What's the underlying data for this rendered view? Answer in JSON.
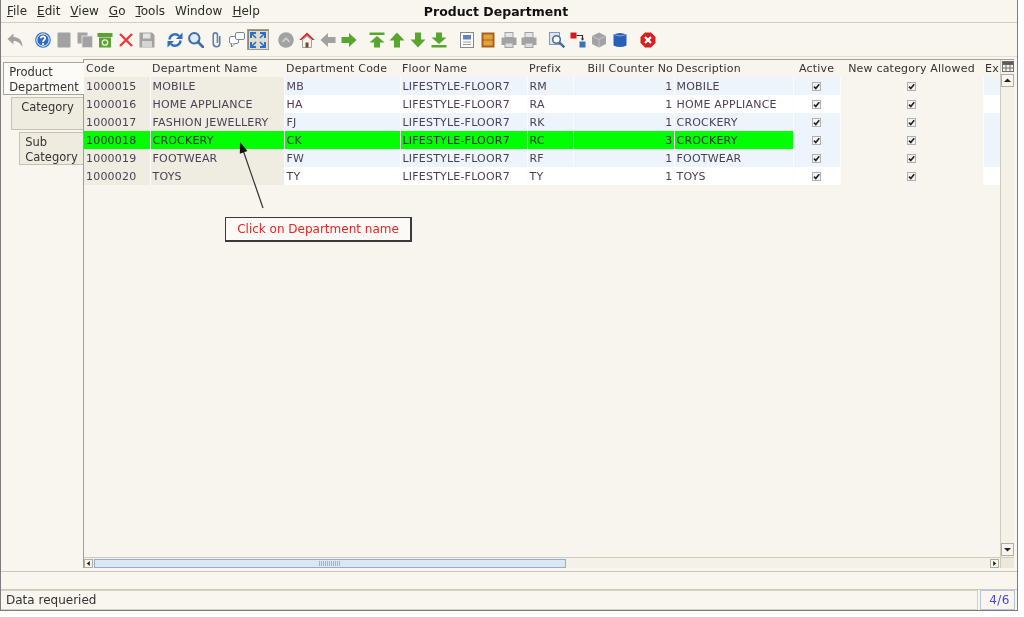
{
  "window": {
    "title": "Product Department"
  },
  "menu": [
    {
      "label": "File",
      "mnemonic": true
    },
    {
      "label": "Edit",
      "mnemonic": true
    },
    {
      "label": "View",
      "mnemonic": true
    },
    {
      "label": "Go",
      "mnemonic": true
    },
    {
      "label": "Tools",
      "mnemonic": true
    },
    {
      "label": "Window",
      "mnemonic": false
    },
    {
      "label": "Help",
      "mnemonic": true
    }
  ],
  "toolbar": [
    {
      "items": [
        {
          "disabled": true,
          "pressed": false
        }
      ]
    },
    {
      "items": [
        {
          "disabled": false,
          "pressed": false
        },
        {
          "disabled": true,
          "pressed": false
        },
        {
          "disabled": true,
          "pressed": false
        },
        {
          "disabled": false,
          "pressed": false
        },
        {
          "disabled": false,
          "pressed": false
        },
        {
          "disabled": true,
          "pressed": false
        }
      ]
    },
    {
      "items": [
        {
          "disabled": false,
          "pressed": false
        },
        {
          "disabled": false,
          "pressed": false
        },
        {
          "disabled": false,
          "pressed": false
        },
        {
          "disabled": false,
          "pressed": false
        },
        {
          "disabled": false,
          "pressed": true
        }
      ]
    },
    {
      "items": [
        {
          "disabled": true,
          "pressed": false
        },
        {
          "disabled": false,
          "pressed": false
        },
        {
          "disabled": true,
          "pressed": false
        },
        {
          "disabled": false,
          "pressed": false
        }
      ]
    },
    {
      "items": [
        {
          "disabled": false,
          "pressed": false
        },
        {
          "disabled": false,
          "pressed": false
        },
        {
          "disabled": false,
          "pressed": false
        },
        {
          "disabled": false,
          "pressed": false
        }
      ]
    },
    {
      "items": [
        {
          "disabled": false,
          "pressed": false
        },
        {
          "disabled": false,
          "pressed": false
        },
        {
          "disabled": true,
          "pressed": false
        },
        {
          "disabled": true,
          "pressed": false
        }
      ]
    },
    {
      "items": [
        {
          "disabled": false,
          "pressed": false
        },
        {
          "disabled": false,
          "pressed": false
        },
        {
          "disabled": true,
          "pressed": false
        },
        {
          "disabled": false,
          "pressed": false
        }
      ]
    },
    {
      "items": [
        {
          "disabled": false,
          "pressed": false
        }
      ]
    }
  ],
  "tabs": [
    {
      "label": "Product Department",
      "selected": true
    },
    {
      "label": "Category",
      "selected": false
    },
    {
      "label": "Sub Category",
      "selected": false
    }
  ],
  "table": {
    "columns": [
      {
        "label": "Code",
        "kind": "text",
        "readonly": true
      },
      {
        "label": "Department Name",
        "kind": "text",
        "readonly": true
      },
      {
        "label": "Department Code",
        "kind": "text",
        "readonly": false
      },
      {
        "label": "Floor Name",
        "kind": "text",
        "readonly": false
      },
      {
        "label": "Prefix",
        "kind": "text",
        "readonly": false
      },
      {
        "label": "Bill Counter No",
        "kind": "number",
        "readonly": false
      },
      {
        "label": "Description",
        "kind": "text",
        "readonly": false
      },
      {
        "label": "Active",
        "kind": "checkbox",
        "readonly": false
      },
      {
        "label": "New category Allowed",
        "kind": "checkbox",
        "readonly": true
      },
      {
        "label": "Ex",
        "kind": "text",
        "readonly": false
      }
    ],
    "rows": [
      {
        "selected": false,
        "cells": [
          "1000015",
          "MOBILE",
          "MB",
          "LIFESTYLE-FLOOR7",
          "RM",
          "1",
          "MOBILE",
          {
            "checked": true
          },
          {
            "checked": true
          }
        ]
      },
      {
        "selected": false,
        "cells": [
          "1000016",
          "HOME APPLIANCE",
          "HA",
          "LIFESTYLE-FLOOR7",
          "RA",
          "1",
          "HOME APPLIANCE",
          {
            "checked": true
          },
          {
            "checked": true
          }
        ]
      },
      {
        "selected": false,
        "cells": [
          "1000017",
          "FASHION JEWELLERY",
          "FJ",
          "LIFESTYLE-FLOOR7",
          "RK",
          "1",
          "CROCKERY",
          {
            "checked": true
          },
          {
            "checked": true
          }
        ]
      },
      {
        "selected": true,
        "cells": [
          "1000018",
          "CROCKERY",
          "CK",
          "LIFESTYLE-FLOOR7",
          "RC",
          "3",
          "CROCKERY",
          {
            "checked": true
          },
          {
            "checked": true
          }
        ]
      },
      {
        "selected": false,
        "cells": [
          "1000019",
          "FOOTWEAR",
          "FW",
          "LIFESTYLE-FLOOR7",
          "RF",
          "1",
          "FOOTWEAR",
          {
            "checked": true
          },
          {
            "checked": true
          }
        ]
      },
      {
        "selected": false,
        "cells": [
          "1000020",
          "TOYS",
          "TY",
          "LIFESTYLE-FLOOR7",
          "TY",
          "1",
          "TOYS",
          {
            "checked": true
          },
          {
            "checked": true
          }
        ]
      }
    ]
  },
  "annotation": {
    "text": "Click on Department name"
  },
  "status_bar": {
    "message": "Data requeried",
    "record": "4/6"
  }
}
